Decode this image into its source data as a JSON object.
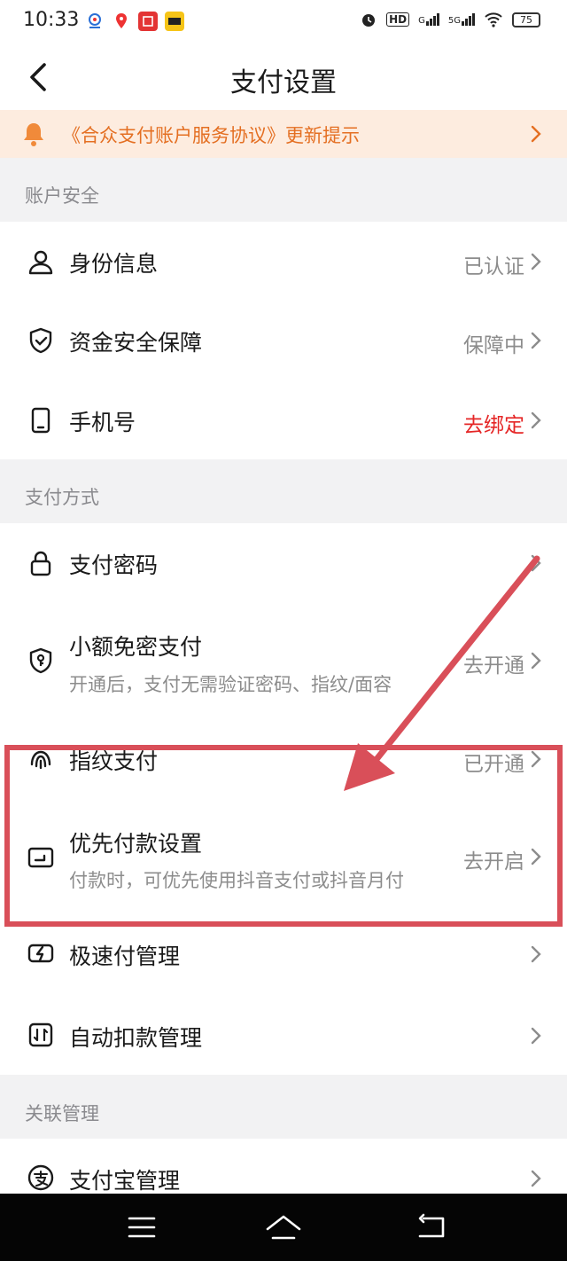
{
  "status_bar": {
    "time": "10:33",
    "battery": "75",
    "network_1": "HD",
    "network_2": "G",
    "network_3": "5G"
  },
  "header": {
    "title": "支付设置"
  },
  "notice": {
    "text": "《合众支付账户服务协议》更新提示"
  },
  "sections": {
    "account_security": "账户安全",
    "payment_methods": "支付方式",
    "linked_management": "关联管理"
  },
  "account_security_items": [
    {
      "label": "身份信息",
      "value": "已认证",
      "icon": "person-icon"
    },
    {
      "label": "资金安全保障",
      "value": "保障中",
      "icon": "shield-check-icon"
    },
    {
      "label": "手机号",
      "value": "去绑定",
      "icon": "phone-icon"
    }
  ],
  "payment_items": [
    {
      "label": "支付密码",
      "value": "",
      "icon": "lock-icon"
    },
    {
      "label": "小额免密支付",
      "sub": "开通后，支付无需验证密码、指纹/面容",
      "value": "去开通",
      "icon": "shield-key-icon"
    },
    {
      "label": "指纹支付",
      "value": "已开通",
      "icon": "fingerprint-icon"
    },
    {
      "label": "优先付款设置",
      "sub": "付款时，可优先使用抖音支付或抖音月付",
      "value": "去开启",
      "icon": "wallet-icon"
    },
    {
      "label": "极速付管理",
      "value": "",
      "icon": "lightning-icon"
    },
    {
      "label": "自动扣款管理",
      "value": "",
      "icon": "auto-debit-icon"
    }
  ],
  "linked_items": [
    {
      "label": "支付宝管理",
      "value": "",
      "icon": "alipay-icon"
    }
  ],
  "colors": {
    "accent_orange": "#e46f22",
    "notice_bg": "#fdecdf",
    "red_value": "#e52626",
    "annotation": "#d94f59"
  }
}
